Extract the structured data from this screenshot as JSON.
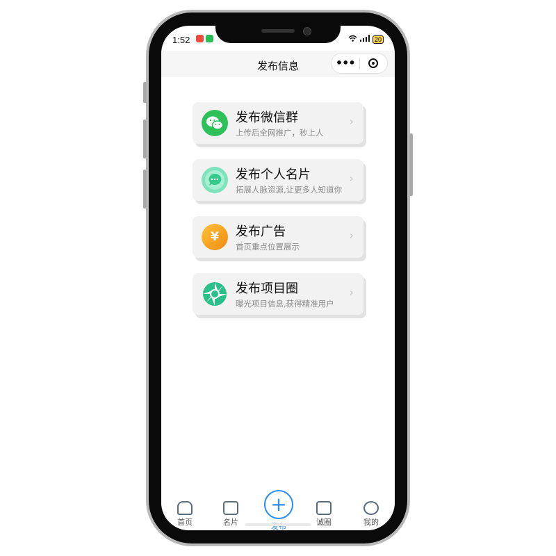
{
  "status_bar": {
    "time": "1:52",
    "battery": "20",
    "badge_colors": [
      "#f04b3c",
      "#2bbd55",
      "#2c8ef0"
    ]
  },
  "nav": {
    "title": "发布信息",
    "more_icon": "more-dots-icon",
    "close_icon": "target-circle-icon"
  },
  "menu": [
    {
      "title": "发布微信群",
      "subtitle": "上传后全网推广，秒上人",
      "icon": "wechat-icon",
      "color": "#2ec15a"
    },
    {
      "title": "发布个人名片",
      "subtitle": "拓展人脉资源,让更多人知道你",
      "icon": "chat-bubble-icon",
      "color": "#6fdcb0"
    },
    {
      "title": "发布广告",
      "subtitle": "首页重点位置展示",
      "icon": "yuan-icon",
      "color": "#f5a11f"
    },
    {
      "title": "发布项目圈",
      "subtitle": "曝光项目信息,获得精准用户",
      "icon": "aperture-icon",
      "color": "#2bbf8a"
    }
  ],
  "tabbar": {
    "home": "首页",
    "card": "名片",
    "publish": "发布",
    "circle": "诚圈",
    "mine": "我的",
    "accent": "#2c8ef0"
  }
}
